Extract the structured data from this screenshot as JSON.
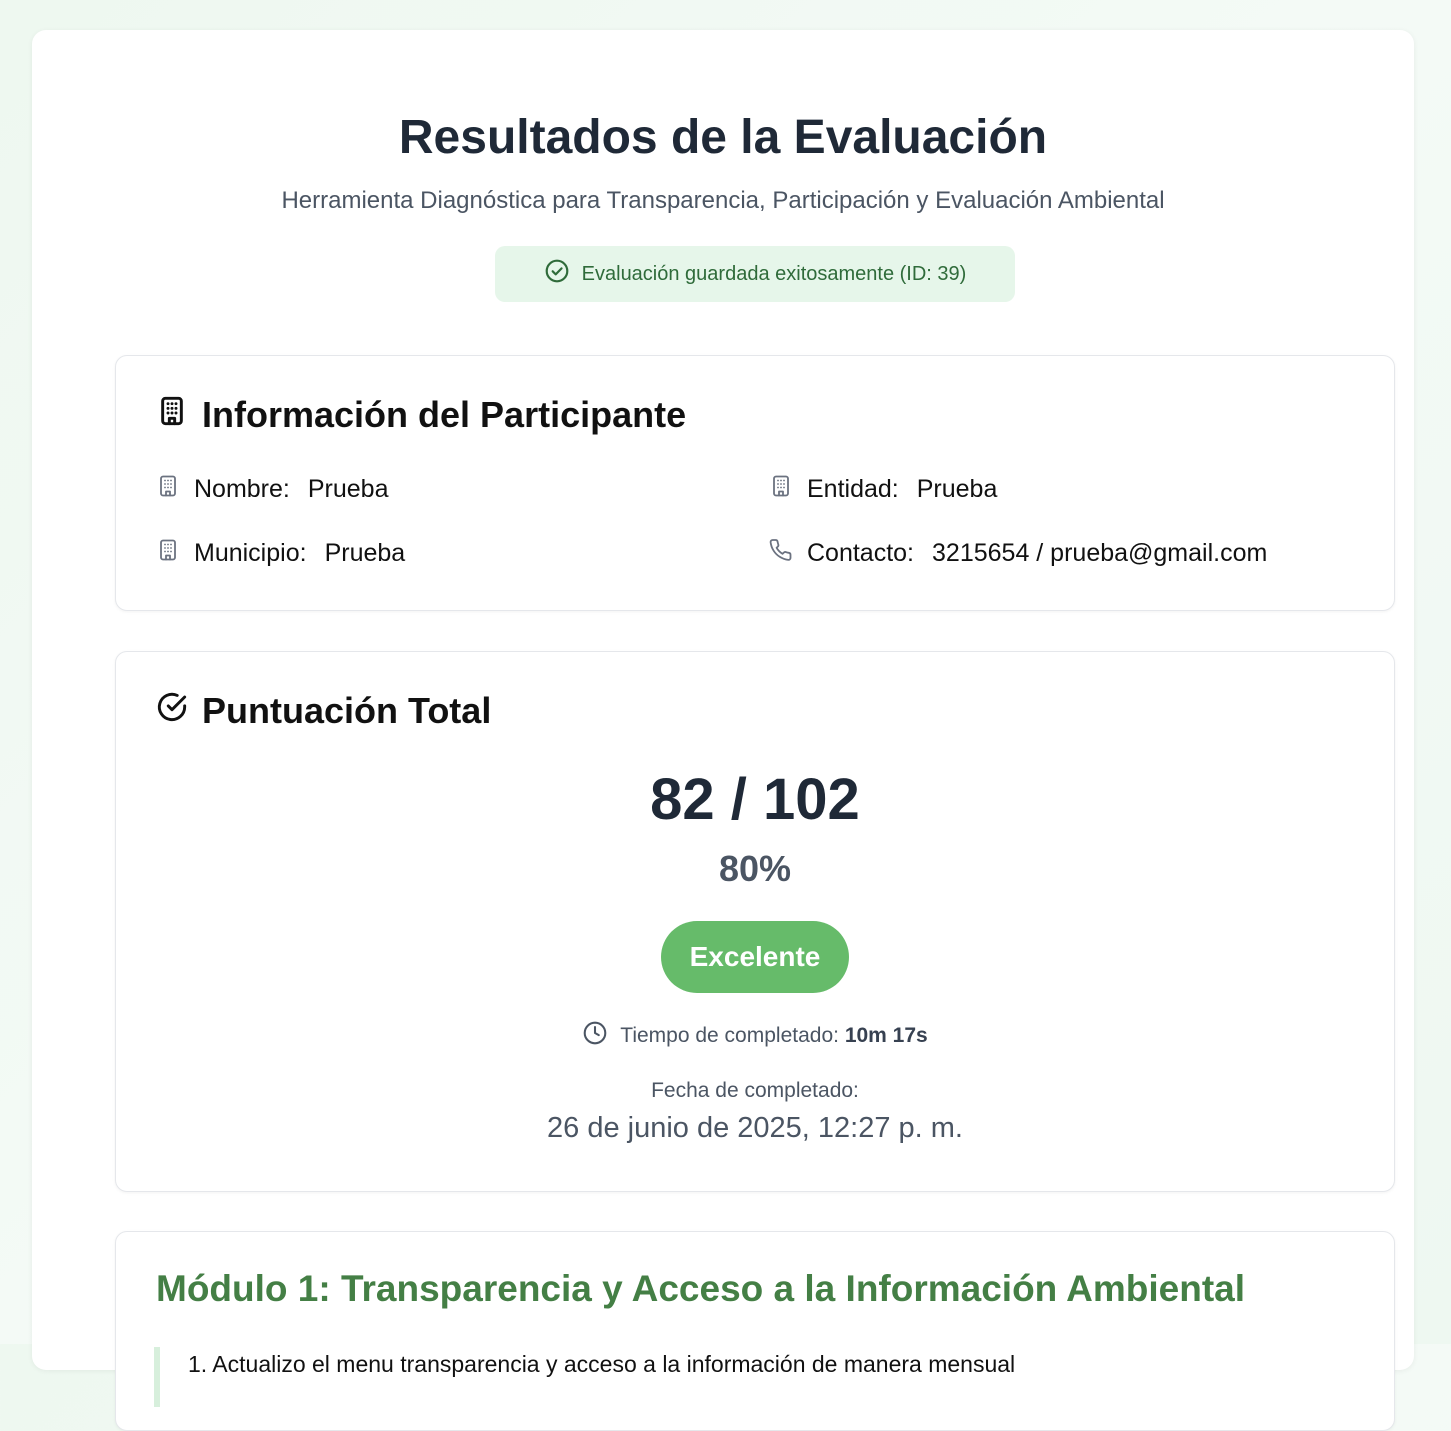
{
  "header": {
    "title": "Resultados de la Evaluación",
    "subtitle": "Herramienta Diagnóstica para Transparencia, Participación y Evaluación Ambiental",
    "saved_message": "Evaluación guardada exitosamente (ID: 39)"
  },
  "participant": {
    "heading": "Información del Participante",
    "fields": [
      {
        "label": "Nombre:",
        "value": "Prueba",
        "icon": "building-icon"
      },
      {
        "label": "Entidad:",
        "value": "Prueba",
        "icon": "building-icon"
      },
      {
        "label": "Municipio:",
        "value": "Prueba",
        "icon": "building-icon"
      },
      {
        "label": "Contacto:",
        "value": "3215654 / prueba@gmail.com",
        "icon": "phone-icon"
      }
    ]
  },
  "score": {
    "heading": "Puntuación Total",
    "value": "82 / 102",
    "percent": "80%",
    "rating": "Excelente",
    "time_label": "Tiempo de completado:",
    "time_value": "10m 17s",
    "date_label": "Fecha de completado:",
    "date_value": "26 de junio de 2025, 12:27 p. m."
  },
  "module": {
    "title": "Módulo 1: Transparencia y Acceso a la Información Ambiental",
    "first_question": "1. Actualizo el menu transparencia y acceso a la información de manera mensual"
  },
  "colors": {
    "accent_green": "#66bb6a",
    "module_title": "#447f45",
    "badge_bg": "#e6f6ea"
  }
}
